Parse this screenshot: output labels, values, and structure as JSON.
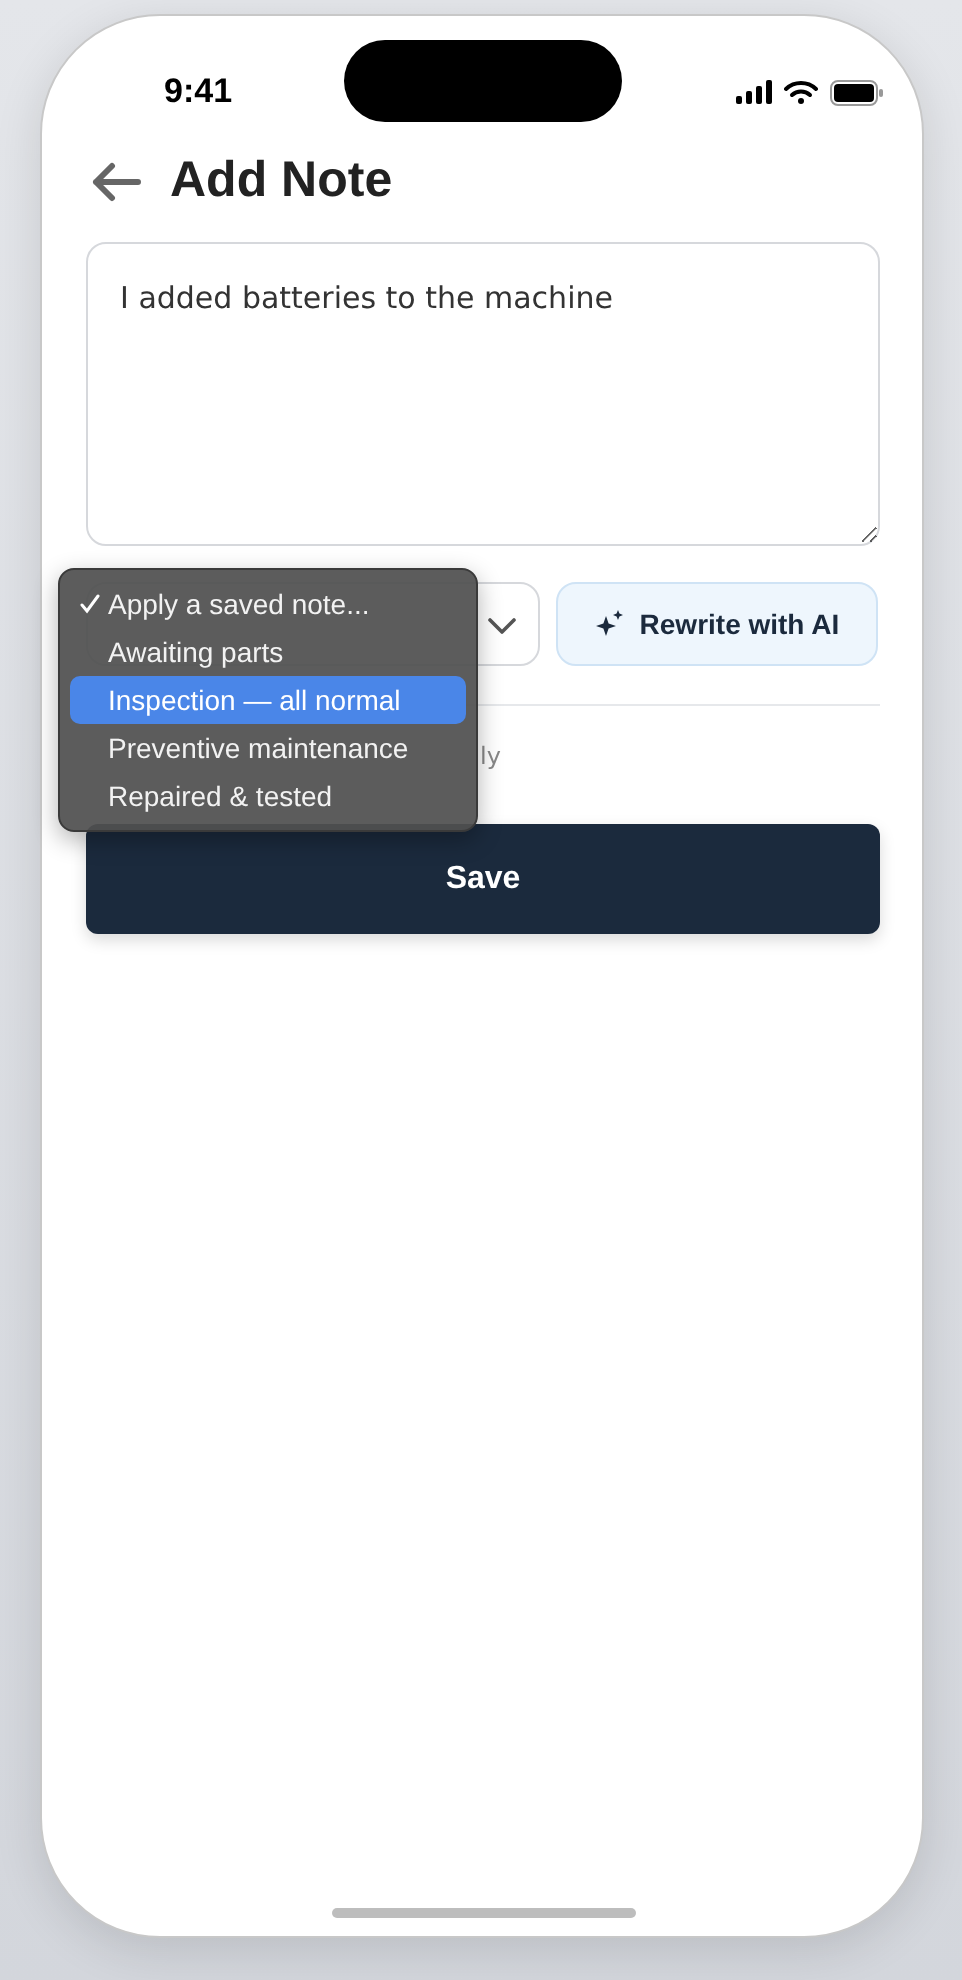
{
  "status_bar": {
    "time": "9:41"
  },
  "header": {
    "title": "Add Note"
  },
  "note_field": {
    "value": "I added batteries to the machine"
  },
  "rewrite_button": {
    "label": "Rewrite with AI"
  },
  "hint_fragment": "ly",
  "saved_note_menu": {
    "items": [
      {
        "label": "Apply a saved note...",
        "checked": true,
        "selected": false
      },
      {
        "label": "Awaiting parts",
        "checked": false,
        "selected": false
      },
      {
        "label": "Inspection — all normal",
        "checked": false,
        "selected": true
      },
      {
        "label": "Preventive maintenance",
        "checked": false,
        "selected": false
      },
      {
        "label": "Repaired & tested",
        "checked": false,
        "selected": false
      }
    ]
  },
  "save_button": {
    "label": "Save"
  }
}
